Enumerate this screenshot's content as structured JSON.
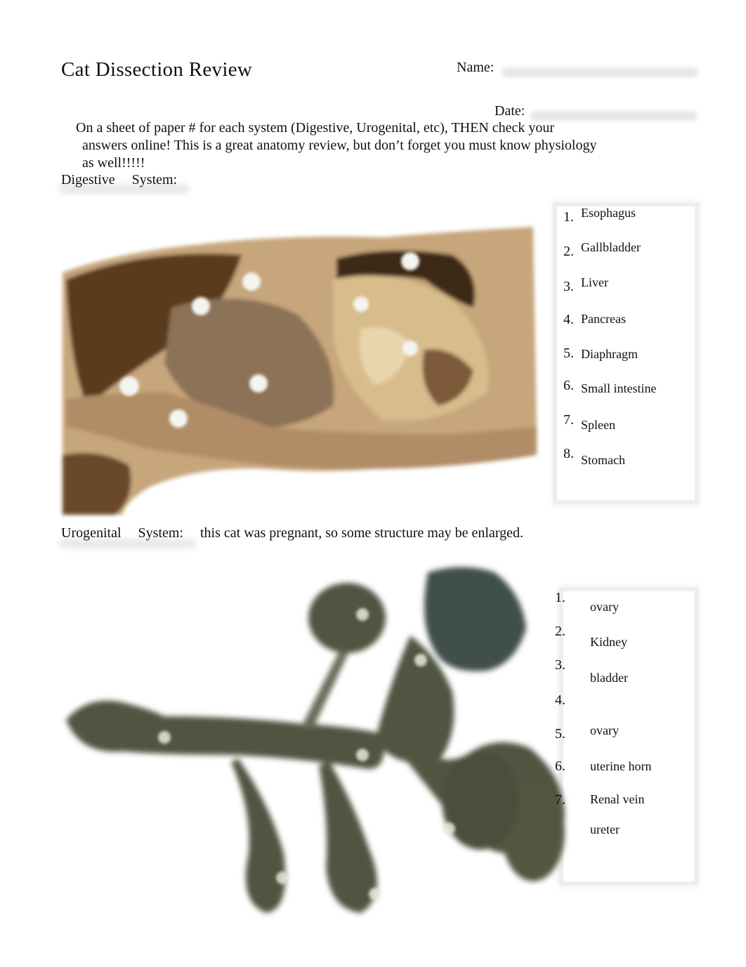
{
  "header": {
    "title": "Cat Dissection Review",
    "name_label": "Name:",
    "date_label": "Date:"
  },
  "instructions": {
    "line1": "On a sheet of paper # for each system (Digestive, Urogenital, etc), THEN check your",
    "line2": "answers online! This is a great anatomy review, but don’t forget you must know physiology",
    "line3": "as well!!!!!"
  },
  "digestive": {
    "heading_part1": "Digestive",
    "heading_part2": "System:",
    "image_label": "digestive-system-dissection-photo",
    "key": [
      {
        "num": "1.",
        "label": "Esophagus"
      },
      {
        "num": "2.",
        "label": "Gallbladder"
      },
      {
        "num": "3.",
        "label": "Liver"
      },
      {
        "num": "4.",
        "label": "Pancreas"
      },
      {
        "num": "5.",
        "label": "Diaphragm"
      },
      {
        "num": "6.",
        "label": "Small intestine"
      },
      {
        "num": "7.",
        "label": "Spleen"
      },
      {
        "num": "8.",
        "label": "Stomach"
      }
    ]
  },
  "urogenital": {
    "heading_part1": "Urogenital",
    "heading_part2": "System:",
    "note": "this cat was pregnant, so some structure may be enlarged.",
    "image_label": "urogenital-system-dissection-photo",
    "key_numbers": [
      "1.",
      "2.",
      "3.",
      "4.",
      "5.",
      "6.",
      "7."
    ],
    "key_labels": [
      "ovary",
      "Kidney",
      "bladder",
      "ovary",
      "uterine horn",
      "Renal vein",
      "ureter"
    ]
  }
}
